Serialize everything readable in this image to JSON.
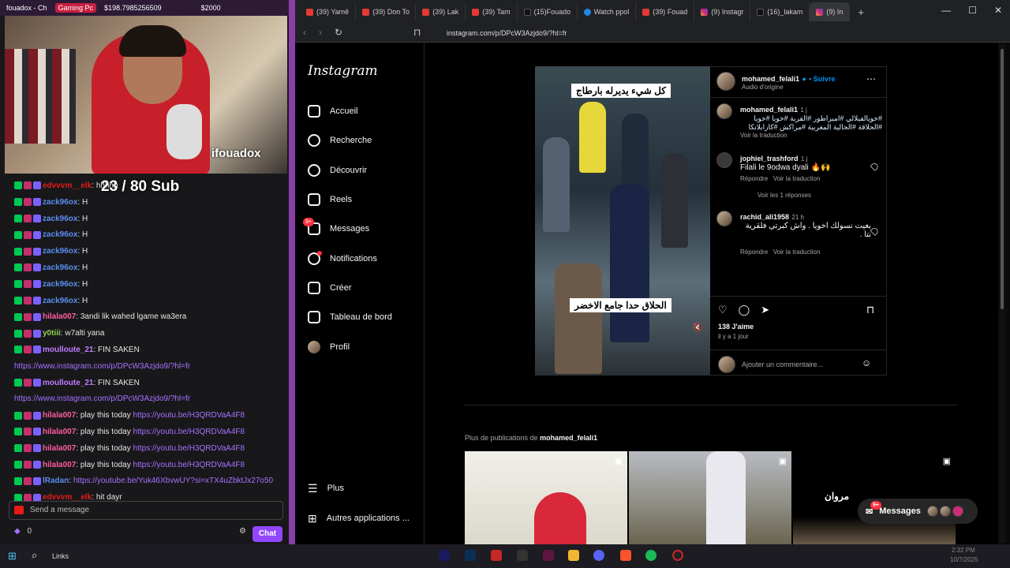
{
  "stream": {
    "window_title": "fouadox - Ch",
    "gaming_pill": "Gaming Pc",
    "amount": "$198.7985256509",
    "goal": "$2000",
    "streamer_handle": "ifouadox",
    "sub_counter": "23 / 80 Sub"
  },
  "chat": {
    "messages": [
      {
        "user": "edvvvm__elk",
        "text": ": h",
        "color": "#e91916",
        "link": "",
        "suffix": "hhhh"
      },
      {
        "user": "zack96ox",
        "text": ": H",
        "color": "#5b8def",
        "link": "",
        "suffix": ""
      },
      {
        "user": "zack96ox",
        "text": ": H",
        "color": "#5b8def",
        "link": "",
        "suffix": ""
      },
      {
        "user": "zack96ox",
        "text": ": H",
        "color": "#5b8def",
        "link": "",
        "suffix": ""
      },
      {
        "user": "zack96ox",
        "text": ": H",
        "color": "#5b8def",
        "link": "",
        "suffix": ""
      },
      {
        "user": "zack96ox",
        "text": ": H",
        "color": "#5b8def",
        "link": "",
        "suffix": ""
      },
      {
        "user": "zack96ox",
        "text": ": H",
        "color": "#5b8def",
        "link": "",
        "suffix": ""
      },
      {
        "user": "zack96ox",
        "text": ": H",
        "color": "#5b8def",
        "link": "",
        "suffix": ""
      },
      {
        "user": "hilala007",
        "text": ": 3andi lik wahed lgame wa3era",
        "color": "#ff5ca0",
        "link": "",
        "suffix": ""
      },
      {
        "user": "y0tiii",
        "text": ": w7alti yana",
        "color": "#8fd14f",
        "link": "",
        "suffix": ""
      },
      {
        "user": "moulloute_21",
        "text": ": FIN SAKEN",
        "color": "#c07cff",
        "link": "",
        "suffix": ""
      },
      {
        "user": "",
        "text": "",
        "color": "#c07cff",
        "link": "https://www.instagram.com/p/DPcW3Azjdo9/?hl=fr",
        "suffix": ""
      },
      {
        "user": "moulloute_21",
        "text": ": FIN SAKEN",
        "color": "#c07cff",
        "link": "",
        "suffix": ""
      },
      {
        "user": "",
        "text": "",
        "color": "#c07cff",
        "link": "https://www.instagram.com/p/DPcW3Azjdo9/?hl=fr",
        "suffix": ""
      },
      {
        "user": "hilala007",
        "text": ": play this today ",
        "color": "#ff5ca0",
        "link": "https://youtu.be/H3QRDVaA4F8",
        "suffix": ""
      },
      {
        "user": "hilala007",
        "text": ": play this today ",
        "color": "#ff5ca0",
        "link": "https://youtu.be/H3QRDVaA4F8",
        "suffix": ""
      },
      {
        "user": "hilala007",
        "text": ": play this today ",
        "color": "#ff5ca0",
        "link": "https://youtu.be/H3QRDVaA4F8",
        "suffix": ""
      },
      {
        "user": "hilala007",
        "text": ": play this today ",
        "color": "#ff5ca0",
        "link": "https://youtu.be/H3QRDVaA4F8",
        "suffix": ""
      },
      {
        "user": "lRadan",
        "text": ": ",
        "color": "#5b8def",
        "link": "https://youtube.be/Yuk46XbvwUY?si=xTX4uZbktJx27o50",
        "suffix": ""
      },
      {
        "user": "edvvvm__elk",
        "text": ": hit dayr",
        "color": "#e91916",
        "link": "",
        "suffix": ""
      }
    ],
    "input_placeholder": "Send a message",
    "points": "0",
    "chat_button": "Chat"
  },
  "browser": {
    "tabs": [
      "(39) Yamê",
      "(39) Don To",
      "(39) Lak",
      "(39) Tam",
      "(15)Fouado",
      "Watch ppol",
      "(39) Fouad",
      "(9) Instagr",
      "(16)_lakam",
      "(9) In"
    ],
    "url": "instagram.com/p/DPcW3Azjdo9/?hl=fr"
  },
  "instagram": {
    "logo": "Instagram",
    "nav": [
      "Accueil",
      "Recherche",
      "Découvrir",
      "Reels",
      "Messages",
      "Notifications",
      "Créer",
      "Tableau de bord",
      "Profil"
    ],
    "messages_badge": "9+",
    "nav_more": "Plus",
    "nav_other": "Autres applications ...",
    "post": {
      "caption_top": "كل شيء يديرله بارطاج",
      "caption_bottom": "الحلاق حدا جامع الاخضر",
      "author": "mohamed_felali1",
      "follow": "• Suivre",
      "audio": "Audio d'origine",
      "desc_author": "mohamed_felali1",
      "desc_time": "1 j",
      "desc_text": "#خويالفيلالي #امبراطور #القرية #خويا #خويا #الحلاقة #الحالية المغربية #مراكش #كازابلانكا",
      "see_translation": "Voir la traduction",
      "comments": [
        {
          "user": "jophiel_trashford",
          "time": "1 j",
          "text": "Filali le 9odwa dyali 🔥🙌",
          "reply": "Répondre",
          "translate": "Voir la traduction"
        },
        {
          "user": "rachid_ali1958",
          "time": "21 h",
          "text": "بغيت نسولك اخويا . واش كبرتي فلقرية نتا .",
          "reply": "Répondre",
          "translate": "Voir la traduction"
        }
      ],
      "see_replies": "Voir les 1 réponses",
      "likes": "138 J'aime",
      "posted": "il y a 1 jour",
      "comment_placeholder": "Ajouter un commentaire..."
    },
    "more_from_prefix": "Plus de publications de ",
    "more_from_user": "mohamed_felali1",
    "thumb_caption": "مروان",
    "messages_pill": "Messages",
    "messages_pill_badge": "9+"
  },
  "taskbar": {
    "search": "Links",
    "clock_time": "2:32 PM",
    "clock_date": "10/7/2025"
  }
}
